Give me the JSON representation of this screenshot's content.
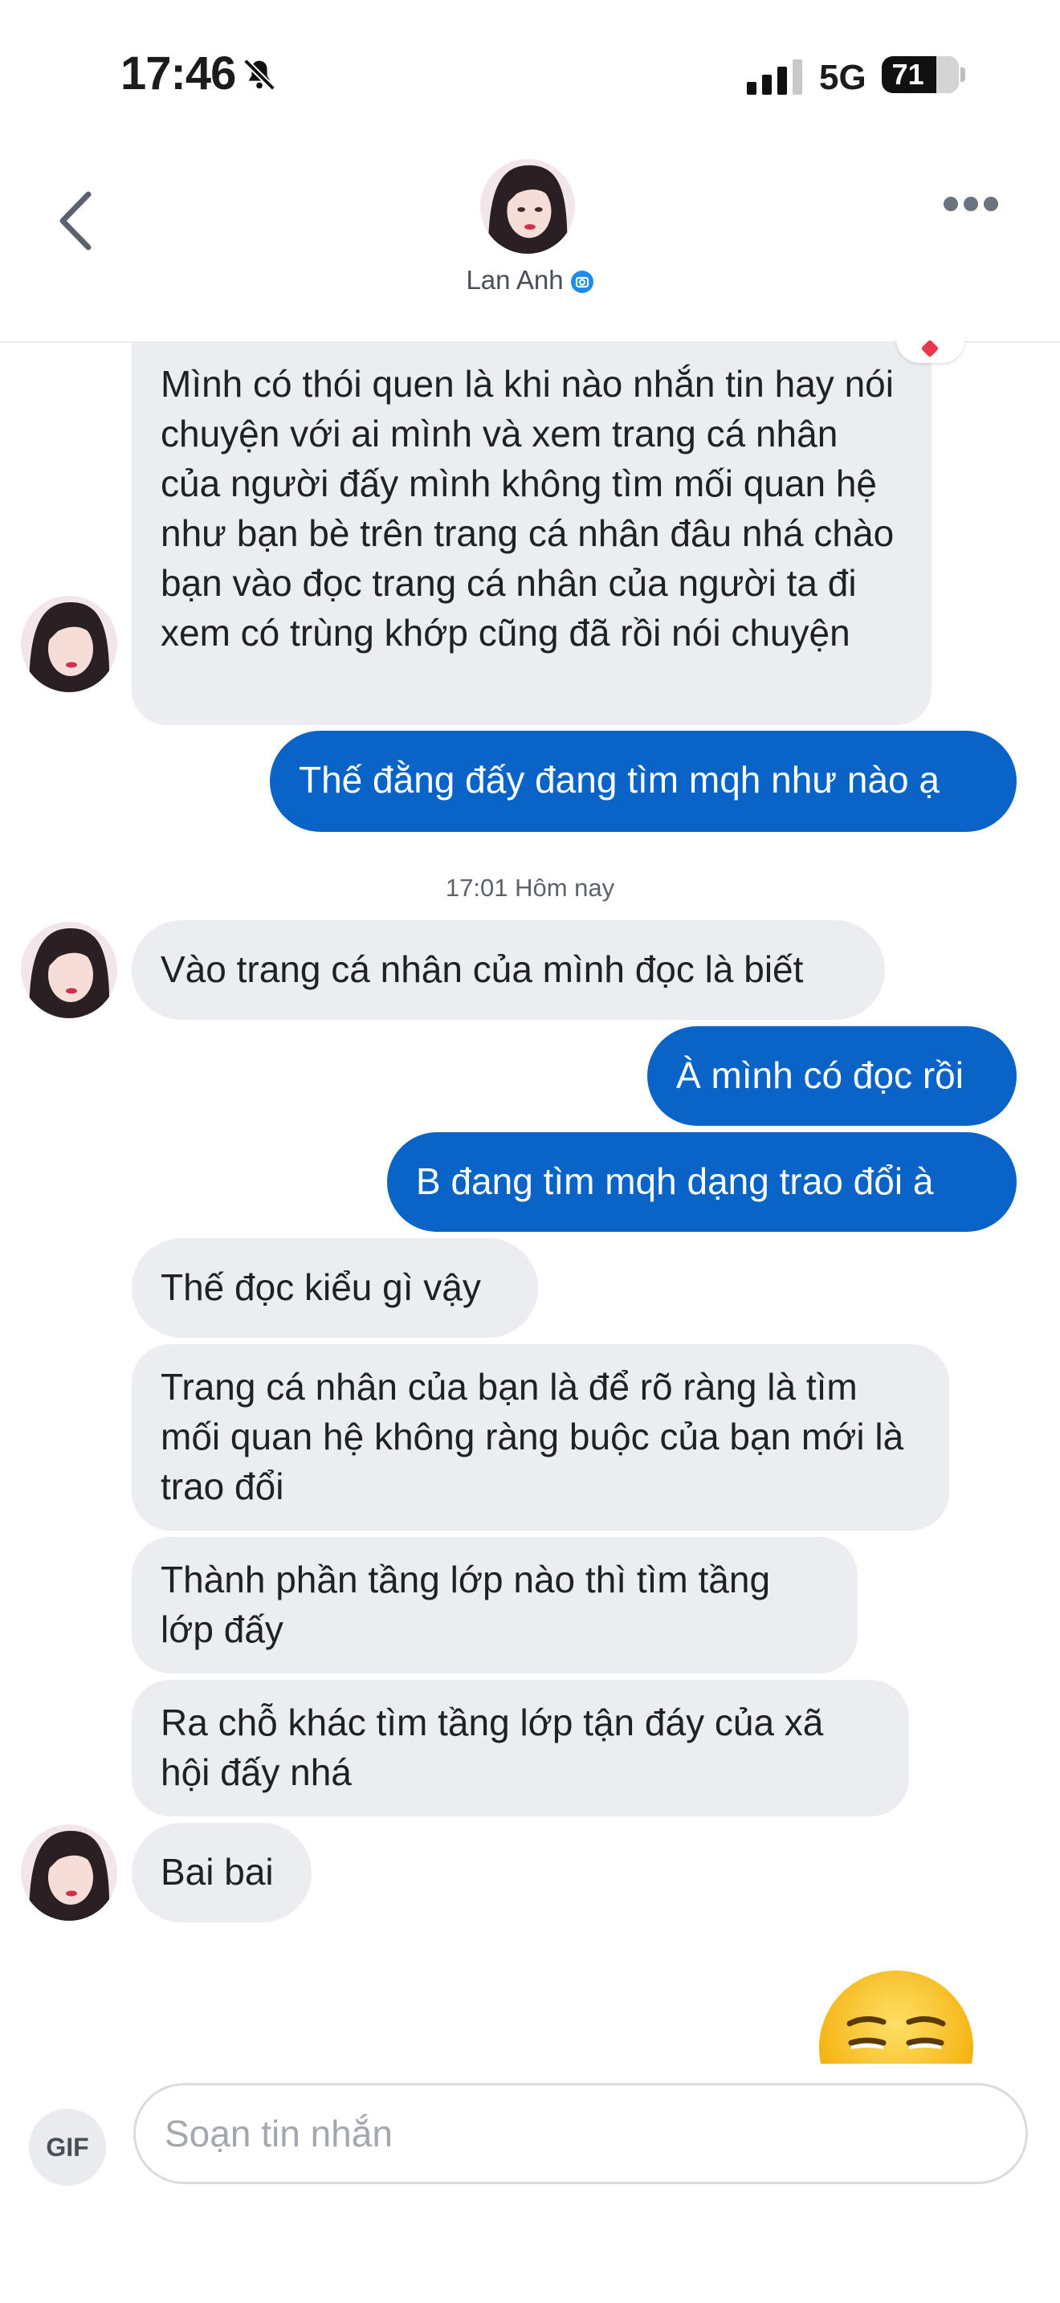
{
  "status_bar": {
    "time": "17:46",
    "network": "5G",
    "battery": "71",
    "icons": [
      "bell-off-icon",
      "signal-icon"
    ]
  },
  "header": {
    "contact_name": "Lan Anh",
    "icons": [
      "chevron-left-icon",
      "more-icon",
      "verified-icon"
    ]
  },
  "messages": [
    {
      "side": "in",
      "text": "Mình có thói quen là khi nào nhắn tin hay nói chuyện với ai mình và xem trang cá nhân của người đấy mình không tìm mối quan hệ như bạn bè trên trang cá nhân đâu nhá chào bạn vào đọc trang cá nhân của người ta đi xem có trùng khớp cũng đã rồi nói chuyện",
      "reaction": "heart"
    },
    {
      "side": "out",
      "text": "Thế đằng đấy đang tìm mqh như nào ạ"
    },
    {
      "side": "in",
      "text": "Vào trang cá nhân của mình đọc là biết"
    },
    {
      "side": "out",
      "text": "À mình có đọc rồi"
    },
    {
      "side": "out",
      "text": "B đang tìm mqh dạng trao đổi à"
    },
    {
      "side": "in",
      "text": "Thế đọc kiểu gì vậy"
    },
    {
      "side": "in",
      "text": "Trang cá nhân của bạn là để rõ ràng là tìm mối quan hệ không ràng buộc của bạn mới là trao đổi"
    },
    {
      "side": "in",
      "text": "Thành phần tầng lớp nào thì tìm tầng lớp đấy"
    },
    {
      "side": "in",
      "text": "Ra chỗ khác tìm tầng lớp tận đáy của xã hội đấy nhá"
    },
    {
      "side": "in",
      "text": "Bai bai"
    },
    {
      "side": "out",
      "emoji": "unamused-face"
    }
  ],
  "timestamp": "17:01 Hôm nay",
  "composer": {
    "gif_label": "GIF",
    "placeholder": "Soạn tin nhắn",
    "value": ""
  }
}
